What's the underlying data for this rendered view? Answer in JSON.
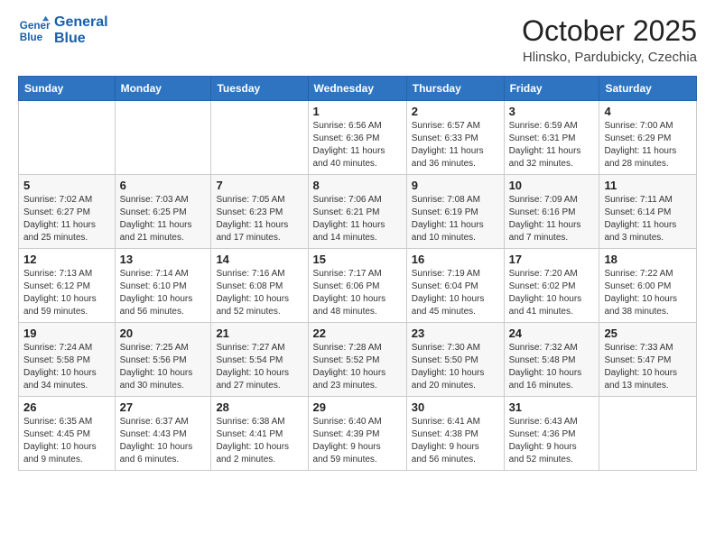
{
  "header": {
    "logo_line1": "General",
    "logo_line2": "Blue",
    "month": "October 2025",
    "location": "Hlinsko, Pardubicky, Czechia"
  },
  "weekdays": [
    "Sunday",
    "Monday",
    "Tuesday",
    "Wednesday",
    "Thursday",
    "Friday",
    "Saturday"
  ],
  "weeks": [
    [
      {
        "day": "",
        "info": ""
      },
      {
        "day": "",
        "info": ""
      },
      {
        "day": "",
        "info": ""
      },
      {
        "day": "1",
        "info": "Sunrise: 6:56 AM\nSunset: 6:36 PM\nDaylight: 11 hours\nand 40 minutes."
      },
      {
        "day": "2",
        "info": "Sunrise: 6:57 AM\nSunset: 6:33 PM\nDaylight: 11 hours\nand 36 minutes."
      },
      {
        "day": "3",
        "info": "Sunrise: 6:59 AM\nSunset: 6:31 PM\nDaylight: 11 hours\nand 32 minutes."
      },
      {
        "day": "4",
        "info": "Sunrise: 7:00 AM\nSunset: 6:29 PM\nDaylight: 11 hours\nand 28 minutes."
      }
    ],
    [
      {
        "day": "5",
        "info": "Sunrise: 7:02 AM\nSunset: 6:27 PM\nDaylight: 11 hours\nand 25 minutes."
      },
      {
        "day": "6",
        "info": "Sunrise: 7:03 AM\nSunset: 6:25 PM\nDaylight: 11 hours\nand 21 minutes."
      },
      {
        "day": "7",
        "info": "Sunrise: 7:05 AM\nSunset: 6:23 PM\nDaylight: 11 hours\nand 17 minutes."
      },
      {
        "day": "8",
        "info": "Sunrise: 7:06 AM\nSunset: 6:21 PM\nDaylight: 11 hours\nand 14 minutes."
      },
      {
        "day": "9",
        "info": "Sunrise: 7:08 AM\nSunset: 6:19 PM\nDaylight: 11 hours\nand 10 minutes."
      },
      {
        "day": "10",
        "info": "Sunrise: 7:09 AM\nSunset: 6:16 PM\nDaylight: 11 hours\nand 7 minutes."
      },
      {
        "day": "11",
        "info": "Sunrise: 7:11 AM\nSunset: 6:14 PM\nDaylight: 11 hours\nand 3 minutes."
      }
    ],
    [
      {
        "day": "12",
        "info": "Sunrise: 7:13 AM\nSunset: 6:12 PM\nDaylight: 10 hours\nand 59 minutes."
      },
      {
        "day": "13",
        "info": "Sunrise: 7:14 AM\nSunset: 6:10 PM\nDaylight: 10 hours\nand 56 minutes."
      },
      {
        "day": "14",
        "info": "Sunrise: 7:16 AM\nSunset: 6:08 PM\nDaylight: 10 hours\nand 52 minutes."
      },
      {
        "day": "15",
        "info": "Sunrise: 7:17 AM\nSunset: 6:06 PM\nDaylight: 10 hours\nand 48 minutes."
      },
      {
        "day": "16",
        "info": "Sunrise: 7:19 AM\nSunset: 6:04 PM\nDaylight: 10 hours\nand 45 minutes."
      },
      {
        "day": "17",
        "info": "Sunrise: 7:20 AM\nSunset: 6:02 PM\nDaylight: 10 hours\nand 41 minutes."
      },
      {
        "day": "18",
        "info": "Sunrise: 7:22 AM\nSunset: 6:00 PM\nDaylight: 10 hours\nand 38 minutes."
      }
    ],
    [
      {
        "day": "19",
        "info": "Sunrise: 7:24 AM\nSunset: 5:58 PM\nDaylight: 10 hours\nand 34 minutes."
      },
      {
        "day": "20",
        "info": "Sunrise: 7:25 AM\nSunset: 5:56 PM\nDaylight: 10 hours\nand 30 minutes."
      },
      {
        "day": "21",
        "info": "Sunrise: 7:27 AM\nSunset: 5:54 PM\nDaylight: 10 hours\nand 27 minutes."
      },
      {
        "day": "22",
        "info": "Sunrise: 7:28 AM\nSunset: 5:52 PM\nDaylight: 10 hours\nand 23 minutes."
      },
      {
        "day": "23",
        "info": "Sunrise: 7:30 AM\nSunset: 5:50 PM\nDaylight: 10 hours\nand 20 minutes."
      },
      {
        "day": "24",
        "info": "Sunrise: 7:32 AM\nSunset: 5:48 PM\nDaylight: 10 hours\nand 16 minutes."
      },
      {
        "day": "25",
        "info": "Sunrise: 7:33 AM\nSunset: 5:47 PM\nDaylight: 10 hours\nand 13 minutes."
      }
    ],
    [
      {
        "day": "26",
        "info": "Sunrise: 6:35 AM\nSunset: 4:45 PM\nDaylight: 10 hours\nand 9 minutes."
      },
      {
        "day": "27",
        "info": "Sunrise: 6:37 AM\nSunset: 4:43 PM\nDaylight: 10 hours\nand 6 minutes."
      },
      {
        "day": "28",
        "info": "Sunrise: 6:38 AM\nSunset: 4:41 PM\nDaylight: 10 hours\nand 2 minutes."
      },
      {
        "day": "29",
        "info": "Sunrise: 6:40 AM\nSunset: 4:39 PM\nDaylight: 9 hours\nand 59 minutes."
      },
      {
        "day": "30",
        "info": "Sunrise: 6:41 AM\nSunset: 4:38 PM\nDaylight: 9 hours\nand 56 minutes."
      },
      {
        "day": "31",
        "info": "Sunrise: 6:43 AM\nSunset: 4:36 PM\nDaylight: 9 hours\nand 52 minutes."
      },
      {
        "day": "",
        "info": ""
      }
    ]
  ]
}
